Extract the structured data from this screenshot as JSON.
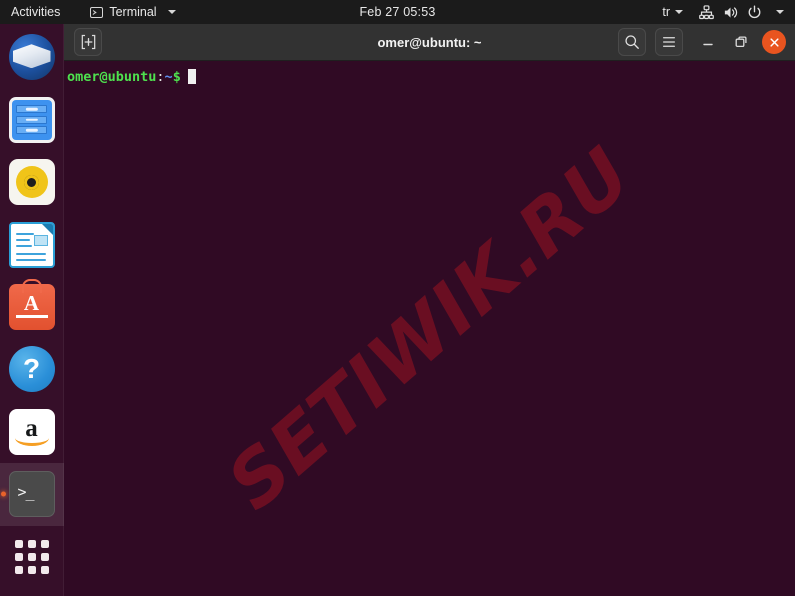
{
  "topbar": {
    "activities": "Activities",
    "app_menu": {
      "label": "Terminal",
      "icon": "terminal-icon"
    },
    "clock": "Feb 27  05:53",
    "language": "tr",
    "status_icons": [
      "network-icon",
      "volume-icon",
      "power-icon",
      "chevron-down-icon"
    ],
    "accent": "#e8622a"
  },
  "dock": {
    "background": "#3c142d",
    "running_indicator_color": "#e8622a",
    "items": [
      {
        "name": "thunderbird",
        "label": "Thunderbird Mail",
        "running": false
      },
      {
        "name": "files",
        "label": "Files",
        "running": false
      },
      {
        "name": "rhythmbox",
        "label": "Rhythmbox",
        "running": false
      },
      {
        "name": "libreoffice-writer",
        "label": "LibreOffice Writer",
        "running": false
      },
      {
        "name": "ubuntu-software",
        "label": "Ubuntu Software",
        "running": false
      },
      {
        "name": "help",
        "label": "Help",
        "running": false
      },
      {
        "name": "amazon",
        "label": "Amazon",
        "running": false
      },
      {
        "name": "terminal",
        "label": "Terminal",
        "running": true
      }
    ],
    "show_apps": {
      "label": "Show Applications",
      "icon": "grid-icon"
    }
  },
  "window": {
    "title": "omer@ubuntu: ~",
    "titlebar_color": "#323232",
    "buttons": {
      "new_tab": "new-tab-icon",
      "search": "search-icon",
      "menu": "hamburger-menu-icon",
      "minimize": "minimize-icon",
      "maximize": "maximize-icon",
      "close": "close-icon",
      "close_color": "#e9541f"
    }
  },
  "terminal": {
    "background": "#300a24",
    "prompt": {
      "user_host": "omer@ubuntu",
      "colon": ":",
      "path": "~",
      "symbol": "$"
    },
    "cursor": "block",
    "watermark": {
      "text": "SETIWIK.RU",
      "color": "#8e1222",
      "rotation_deg": -41
    }
  }
}
